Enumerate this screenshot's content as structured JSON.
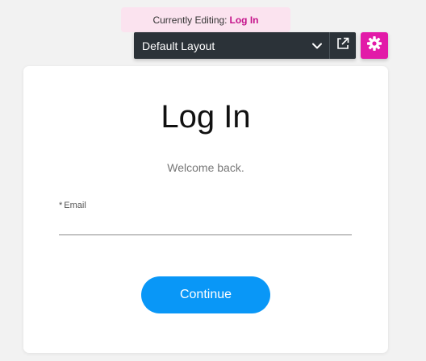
{
  "editor": {
    "banner_prefix": "Currently Editing:",
    "banner_page": "Log In",
    "layout_selected": "Default Layout",
    "icons": {
      "dropdown": "chevron-down-icon",
      "popout": "external-link-icon",
      "settings": "gear-icon"
    },
    "colors": {
      "accent": "#e21aa8",
      "toolbar": "#2b3238",
      "banner_bg": "#fbe3ef"
    }
  },
  "login": {
    "title": "Log In",
    "subtitle": "Welcome back.",
    "email_required_mark": "*",
    "email_label": "Email",
    "email_value": "",
    "continue_label": "Continue",
    "colors": {
      "button": "#0997f7"
    }
  }
}
